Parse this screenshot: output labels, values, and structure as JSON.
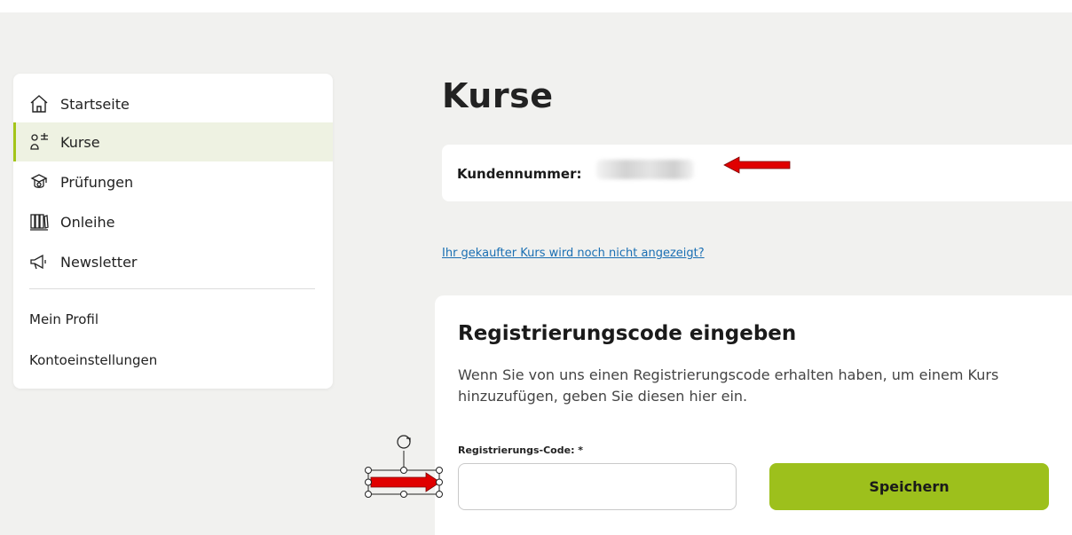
{
  "sidebar": {
    "items": [
      {
        "label": "Startseite",
        "icon": "home-icon"
      },
      {
        "label": "Kurse",
        "icon": "course-icon",
        "active": true
      },
      {
        "label": "Prüfungen",
        "icon": "exam-icon"
      },
      {
        "label": "Onleihe",
        "icon": "library-icon"
      },
      {
        "label": "Newsletter",
        "icon": "megaphone-icon"
      }
    ],
    "links": [
      "Mein Profil",
      "Kontoeinstellungen"
    ]
  },
  "main": {
    "title": "Kurse",
    "customer_label": "Kundennummer:",
    "help_link": "Ihr gekaufter Kurs wird noch nicht angezeigt?",
    "register": {
      "title": "Registrierungscode eingeben",
      "description": "Wenn Sie von uns einen Registrierungscode erhalten haben, um einem Kurs hinzuzufügen, geben Sie diesen hier ein.",
      "field_label": "Registrierungs-Code: *",
      "input_value": "",
      "save_label": "Speichern"
    }
  },
  "colors": {
    "accent": "#9dc01c",
    "active_bg": "#eef2e2",
    "page_bg": "#f1f1ef",
    "annotation_arrow": "#e00000"
  }
}
